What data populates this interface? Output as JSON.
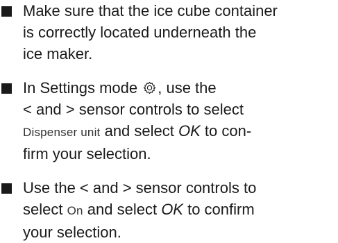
{
  "steps": [
    {
      "lines": [
        "Make sure that the ice cube container",
        "is correctly located underneath the",
        "ice maker."
      ]
    },
    {
      "l1_a": "In Settings mode",
      "l1_b": ", use the",
      "l2": "< and > sensor controls to select",
      "l3_display": "Dispenser unit",
      "l3_mid": " and select ",
      "l3_ok": "OK",
      "l3_end": " to con-",
      "l4": "firm your selection."
    },
    {
      "l1": "Use the < and > sensor controls to",
      "l2_a": "select ",
      "l2_display": "On",
      "l2_mid": " and select ",
      "l2_ok": "OK",
      "l2_end": " to confirm",
      "l3": "your selection."
    }
  ],
  "icons": {
    "settings": "gear-icon",
    "bullet": "square-bullet"
  },
  "colors": {
    "text": "#1a1a1a"
  }
}
